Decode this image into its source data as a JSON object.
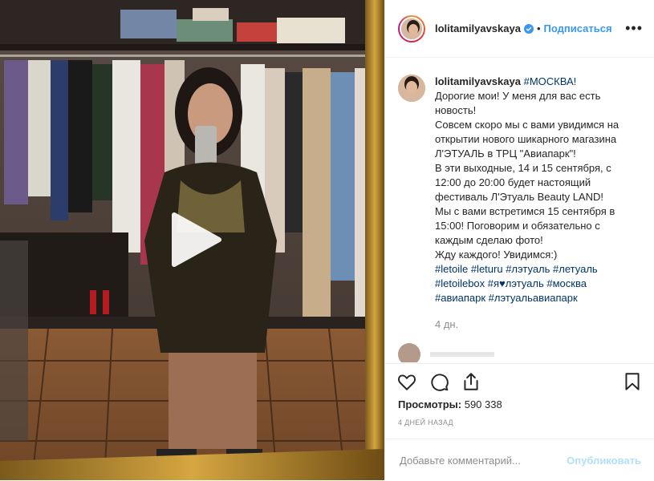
{
  "header": {
    "username": "lolitamilyavskaya",
    "dot": "•",
    "follow_label": "Подписаться",
    "more_label": "•••"
  },
  "caption": {
    "username": "lolitamilyavskaya",
    "lines": [
      "#МОСКВА!",
      "Дорогие мои! У меня для вас есть новость!",
      "Совсем скоро мы с вами увидимся на открытии нового шикарного магазина Л'ЭТУАЛЬ в ТРЦ \"Авиапарк\"!",
      "В эти выходные, 14 и 15 сентября, с 12:00 до 20:00 будет настоящий фестиваль Л'Этуаль Beauty LAND!",
      "Мы с вами встретимся 15 сентября в 15:00! Поговорим и обязательно с каждым сделаю фото!",
      "Жду каждого! Увидимся:)"
    ],
    "hashtags": [
      "#letoile",
      "#leturu",
      "#лэтуаль",
      "#летуаль",
      "#letoilebox",
      "#я♥лэтуаль",
      "#москва",
      "#авиапарк",
      "#лэтуальавиапарк"
    ],
    "time": "4 дн."
  },
  "stats": {
    "views_label": "Просмотры:",
    "views_value": "590 338",
    "date": "4 ДНЕЙ НАЗАД"
  },
  "comment": {
    "placeholder": "Добавьте комментарий...",
    "publish_label": "Опубликовать"
  },
  "colors": {
    "accent": "#3897f0",
    "hashtag": "#003569",
    "publish_disabled": "#b2dffc",
    "muted": "#8e8e8e"
  },
  "icons": [
    "verified-badge-icon",
    "play-icon",
    "heart-icon",
    "comment-icon",
    "share-icon",
    "bookmark-icon",
    "more-icon"
  ]
}
